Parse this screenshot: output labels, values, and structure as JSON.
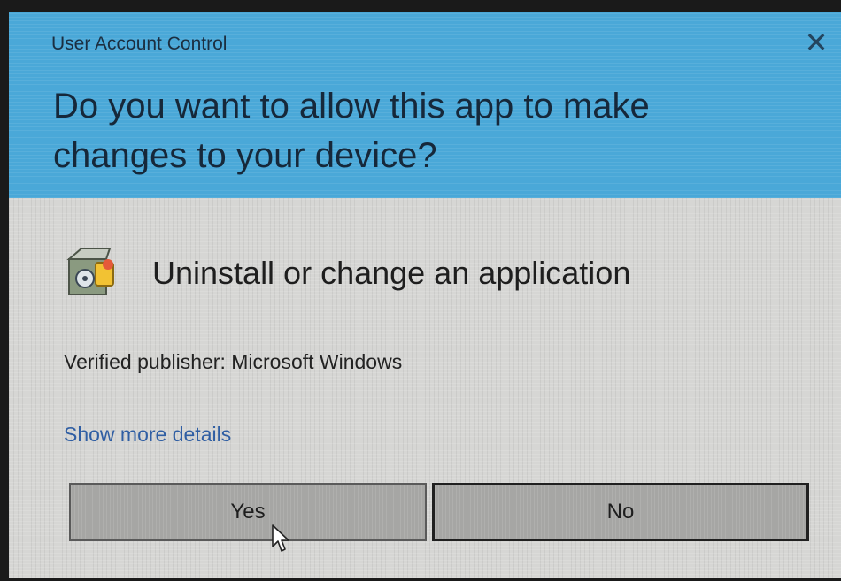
{
  "window": {
    "title": "User Account Control",
    "close_icon": "close-icon",
    "header_color": "#4aa8d8"
  },
  "prompt": {
    "question": "Do you want to allow this app to make changes to your device?"
  },
  "app": {
    "icon": "program-uninstall-icon",
    "name": "Uninstall or change an application",
    "publisher": "Verified publisher: Microsoft Windows"
  },
  "links": {
    "show_details": "Show more details"
  },
  "buttons": {
    "yes": "Yes",
    "no": "No"
  },
  "pointer": {
    "icon": "mouse-cursor-icon"
  }
}
